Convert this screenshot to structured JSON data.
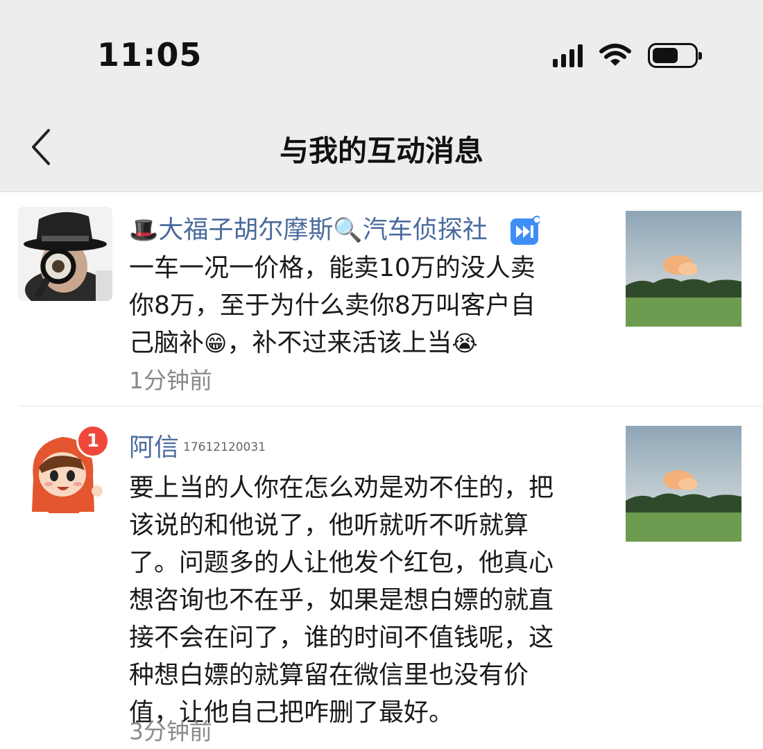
{
  "status_bar": {
    "time": "11:05",
    "icons": [
      "signal-icon",
      "wifi-icon",
      "battery-icon"
    ]
  },
  "nav": {
    "back_icon": "chevron-left-icon",
    "title": "与我的互动消息"
  },
  "colors": {
    "header_bg": "#ededed",
    "name_blue": "#4a6b9c",
    "badge_red": "#f0473b",
    "meta_gray": "#8a8a8a"
  },
  "messages": [
    {
      "avatar": "detective-avatar",
      "name_prefix_emoji": "🎩",
      "name_part1": "大福子胡尔摩斯",
      "name_mid_emoji": "🔍",
      "name_part2": "汽车侦探社",
      "vip_icon": "fast-forward-badge-icon",
      "text_lines": [
        "一车一况一价格，能卖10万的没人卖",
        "你8万，至于为什么卖你8万叫客户自",
        "己脑补"
      ],
      "emoji_grin": "😁",
      "text_line3_tail": "，补不过来活该上当",
      "emoji_cry": "😭",
      "time": "1分钟前",
      "thumb": "field-sky-thumbnail"
    },
    {
      "avatar": "cartoon-girl-avatar",
      "badge": "1",
      "name": "阿信",
      "phone": "17612120031",
      "text_lines": [
        "要上当的人你在怎么劝是劝不住的，把",
        "该说的和他说了，他听就听不听就算",
        "了。问题多的人让他发个红包，他真心",
        "想咨询也不在乎，如果是想白嫖的就直",
        "接不会在问了，谁的时间不值钱呢，这",
        "种想白嫖的就算留在微信里也没有价",
        "值，让他自己把咋删了最好。"
      ],
      "time": "3分钟前",
      "thumb": "field-sky-thumbnail"
    }
  ]
}
